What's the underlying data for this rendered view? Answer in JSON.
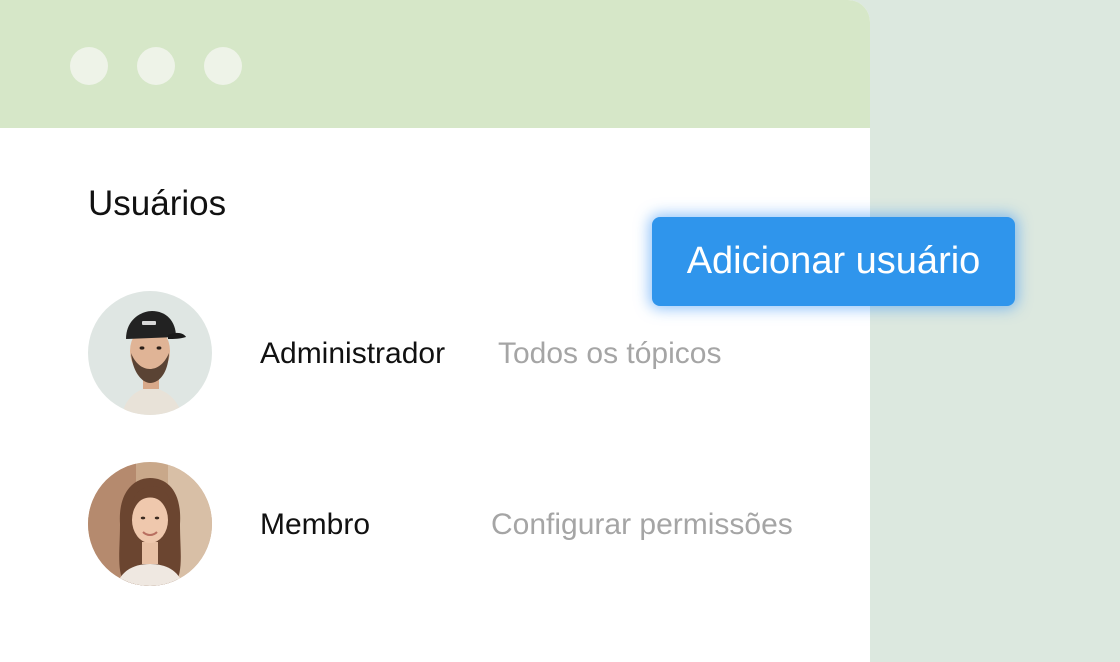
{
  "window": {
    "controls": [
      {
        "name": "window-dot"
      },
      {
        "name": "window-dot"
      },
      {
        "name": "window-dot"
      }
    ]
  },
  "page": {
    "title": "Usuários"
  },
  "add_user_button": {
    "label": "Adicionar usuário"
  },
  "users": [
    {
      "role": "Administrador",
      "permissions": "Todos os tópicos",
      "avatar_icon": "avatar-man-with-cap"
    },
    {
      "role": "Membro",
      "permissions": "Configurar permissões",
      "avatar_icon": "avatar-woman"
    }
  ],
  "colors": {
    "titlebar": "#d6e7c8",
    "background": "#dce8df",
    "button": "#2f95ec",
    "muted_text": "#a5a5a5"
  }
}
